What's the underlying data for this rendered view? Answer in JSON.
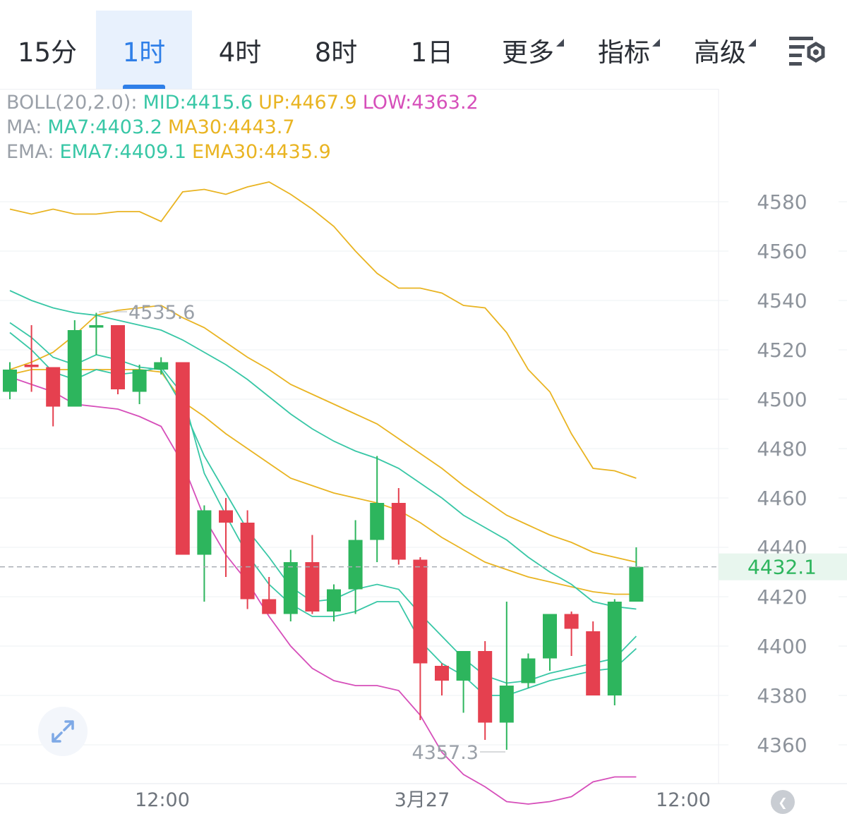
{
  "tabs": [
    {
      "label": "15分",
      "active": false,
      "dropdown": false
    },
    {
      "label": "1时",
      "active": true,
      "dropdown": false
    },
    {
      "label": "4时",
      "active": false,
      "dropdown": false
    },
    {
      "label": "8时",
      "active": false,
      "dropdown": false
    },
    {
      "label": "1日",
      "active": false,
      "dropdown": false
    },
    {
      "label": "更多",
      "active": false,
      "dropdown": true
    },
    {
      "label": "指标",
      "active": false,
      "dropdown": true
    },
    {
      "label": "高级",
      "active": false,
      "dropdown": true
    }
  ],
  "settings_icon": "chart-settings-icon",
  "legend": {
    "boll": {
      "name": "BOLL(20,2.0):",
      "mid": "MID:4415.6",
      "up": "UP:4467.9",
      "low": "LOW:4363.2"
    },
    "ma": {
      "name": "MA:",
      "ma7": "MA7:4403.2",
      "ma30": "MA30:4443.7"
    },
    "ema": {
      "name": "EMA:",
      "ema7": "EMA7:4409.1",
      "ema30": "EMA30:4435.9"
    }
  },
  "colors": {
    "up": "#2db55d",
    "down": "#e5404f",
    "mid": "#38c7a6",
    "upper": "#e9b422",
    "lower": "#d64fba",
    "grey_text": "#9aa0a8",
    "accent": "#2f7fe8"
  },
  "chart_data": {
    "type": "candlestick",
    "y_ticks": [
      4580,
      4560,
      4540,
      4520,
      4500,
      4480,
      4460,
      4440,
      4420,
      4400,
      4380,
      4360
    ],
    "x_labels": [
      "12:00",
      "3月27",
      "12:00"
    ],
    "current_price": "4432.1",
    "high_annotation": "4535.6",
    "low_annotation": "4357.3",
    "candles": [
      {
        "o": 4503,
        "h": 4515,
        "l": 4500,
        "c": 4512
      },
      {
        "o": 4514,
        "h": 4530,
        "l": 4503,
        "c": 4513
      },
      {
        "o": 4513,
        "h": 4511,
        "l": 4489,
        "c": 4497
      },
      {
        "o": 4497,
        "h": 4532,
        "l": 4497,
        "c": 4528
      },
      {
        "o": 4529,
        "h": 4535,
        "l": 4518,
        "c": 4530
      },
      {
        "o": 4530,
        "h": 4530,
        "l": 4502,
        "c": 4504
      },
      {
        "o": 4503,
        "h": 4514,
        "l": 4498,
        "c": 4512
      },
      {
        "o": 4512,
        "h": 4517,
        "l": 4510,
        "c": 4515
      },
      {
        "o": 4515,
        "h": 4515,
        "l": 4438,
        "c": 4437
      },
      {
        "o": 4437,
        "h": 4457,
        "l": 4418,
        "c": 4455
      },
      {
        "o": 4455,
        "h": 4460,
        "l": 4428,
        "c": 4450
      },
      {
        "o": 4450,
        "h": 4455,
        "l": 4415,
        "c": 4419
      },
      {
        "o": 4419,
        "h": 4428,
        "l": 4417,
        "c": 4413
      },
      {
        "o": 4413,
        "h": 4439,
        "l": 4410,
        "c": 4434
      },
      {
        "o": 4434,
        "h": 4445,
        "l": 4413,
        "c": 4414
      },
      {
        "o": 4414,
        "h": 4425,
        "l": 4410,
        "c": 4423
      },
      {
        "o": 4423,
        "h": 4451,
        "l": 4413,
        "c": 4443
      },
      {
        "o": 4443,
        "h": 4477,
        "l": 4434,
        "c": 4458
      },
      {
        "o": 4458,
        "h": 4464,
        "l": 4433,
        "c": 4435
      },
      {
        "o": 4435,
        "h": 4436,
        "l": 4370,
        "c": 4393
      },
      {
        "o": 4392,
        "h": 4393,
        "l": 4380,
        "c": 4386
      },
      {
        "o": 4386,
        "h": 4389,
        "l": 4373,
        "c": 4398
      },
      {
        "o": 4398,
        "h": 4402,
        "l": 4362,
        "c": 4369
      },
      {
        "o": 4369,
        "h": 4418,
        "l": 4358,
        "c": 4384
      },
      {
        "o": 4385,
        "h": 4397,
        "l": 4383,
        "c": 4395
      },
      {
        "o": 4395,
        "h": 4413,
        "l": 4390,
        "c": 4413
      },
      {
        "o": 4413,
        "h": 4414,
        "l": 4396,
        "c": 4407
      },
      {
        "o": 4406,
        "h": 4410,
        "l": 4380,
        "c": 4380
      },
      {
        "o": 4380,
        "h": 4419,
        "l": 4376,
        "c": 4418
      },
      {
        "o": 4418,
        "h": 4440,
        "l": 4418,
        "c": 4432.1
      }
    ],
    "bands": {
      "upper": [
        4577,
        4575,
        4577,
        4575,
        4575,
        4576,
        4576,
        4572,
        4584,
        4585,
        4583,
        4586,
        4588,
        4583,
        4577,
        4570,
        4560,
        4551,
        4545,
        4545,
        4543,
        4538,
        4537,
        4527,
        4512,
        4503,
        4486,
        4472,
        4471,
        4468
      ],
      "ma_upper": [
        4512,
        4515,
        4519,
        4526,
        4534,
        4536,
        4537,
        4538,
        4533,
        4529,
        4523,
        4517,
        4512,
        4506,
        4502,
        4498,
        4494,
        4490,
        4484,
        4478,
        4472,
        4465,
        4459,
        4453,
        4449,
        4445,
        4442,
        4438,
        4436,
        4434
      ],
      "ema_upper": [
        4510,
        4512,
        4512,
        4512,
        4512,
        4512,
        4512,
        4511,
        4499,
        4493,
        4486,
        4480,
        4474,
        4468,
        4465,
        4462,
        4460,
        4458,
        4455,
        4450,
        4444,
        4439,
        4434,
        4431,
        4428,
        4426,
        4424,
        4422,
        4421,
        4421
      ],
      "mid_outer": [
        4544,
        4540,
        4537,
        4535,
        4534,
        4532,
        4530,
        4528,
        4524,
        4519,
        4514,
        4508,
        4501,
        4494,
        4488,
        4483,
        4479,
        4476,
        4472,
        4466,
        4460,
        4453,
        4448,
        4443,
        4436,
        4430,
        4425,
        4418,
        4416,
        4415
      ],
      "mid_inner": [
        4531,
        4525,
        4517,
        4514,
        4518,
        4516,
        4513,
        4512,
        4497,
        4477,
        4462,
        4447,
        4436,
        4424,
        4418,
        4419,
        4423,
        4425,
        4423,
        4413,
        4404,
        4395,
        4388,
        4385,
        4386,
        4389,
        4391,
        4393,
        4395,
        4404
      ],
      "mid_inner2": [
        4527,
        4520,
        4511,
        4508,
        4512,
        4510,
        4511,
        4513,
        4502,
        4470,
        4453,
        4437,
        4425,
        4417,
        4412,
        4412,
        4414,
        4418,
        4418,
        4402,
        4393,
        4388,
        4380,
        4380,
        4383,
        4386,
        4388,
        4390,
        4391,
        4399
      ],
      "lower": [
        4509,
        4506,
        4503,
        4498,
        4497,
        4496,
        4493,
        4489,
        4474,
        4452,
        4437,
        4426,
        4412,
        4400,
        4391,
        4386,
        4384,
        4384,
        4382,
        4372,
        4357,
        4348,
        4343,
        4337,
        4336,
        4337,
        4339,
        4345,
        4347,
        4347
      ]
    }
  }
}
